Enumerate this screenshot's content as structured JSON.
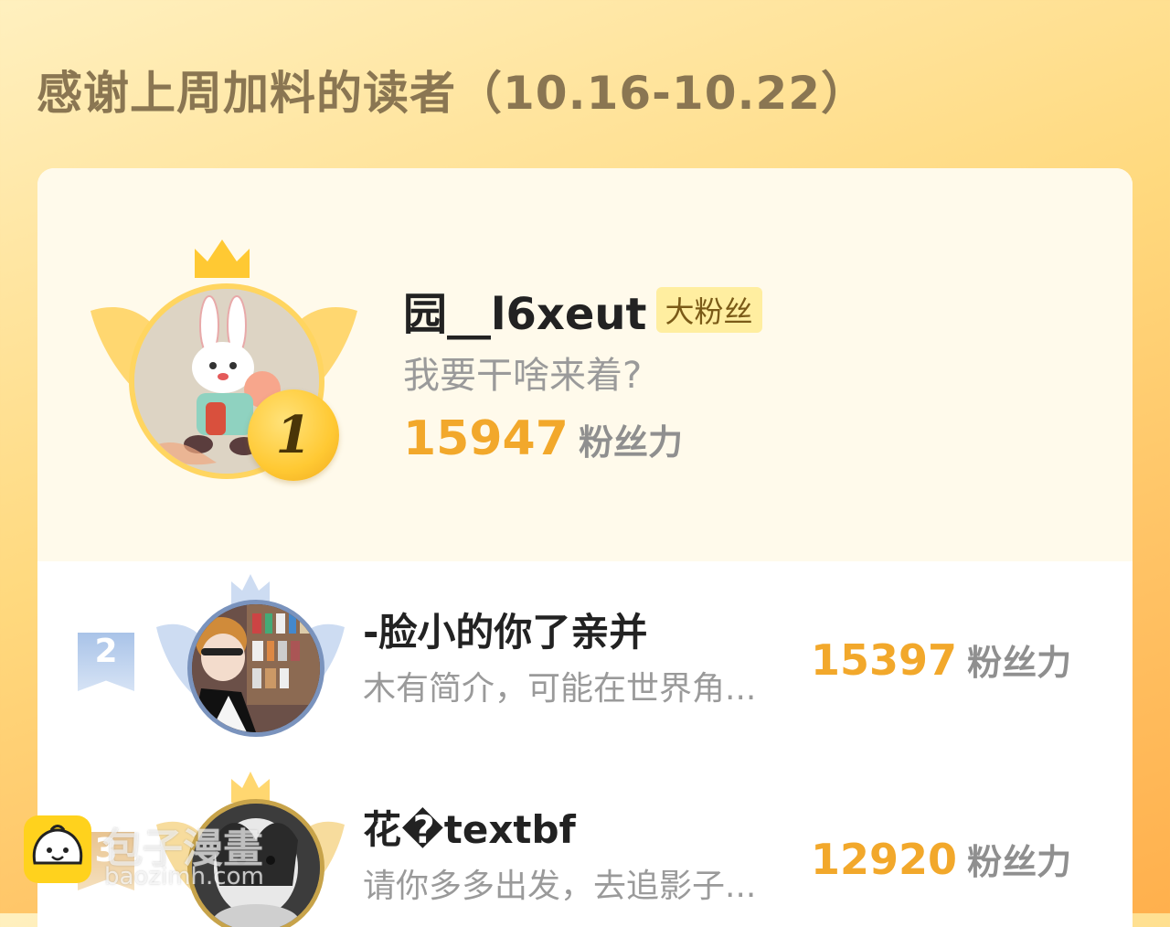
{
  "header": {
    "title": "感谢上周加料的读者（10.16-10.22）"
  },
  "top_fan": {
    "rank": "1",
    "name": "园__l6xeut",
    "badge": "大粉丝",
    "bio": "我要干啥来着?",
    "score": "15947",
    "score_unit": "粉丝力"
  },
  "ranking": [
    {
      "rank": "2",
      "name": "-脸小的你了亲并",
      "bio": "木有简介，可能在世界角...",
      "score": "15397",
      "score_unit": "粉丝力"
    },
    {
      "rank": "3",
      "name": "花�textbf",
      "bio": "请你多多出发，去追影子...",
      "score": "12920",
      "score_unit": "粉丝力"
    }
  ],
  "watermark": {
    "name": "包子漫畫",
    "url": "baozimh.com"
  },
  "colors": {
    "accent_score": "#f2a82b",
    "gold_crown": "#ffc933",
    "silver_wing": "#c5d7f0",
    "title_text": "#8a7652"
  }
}
